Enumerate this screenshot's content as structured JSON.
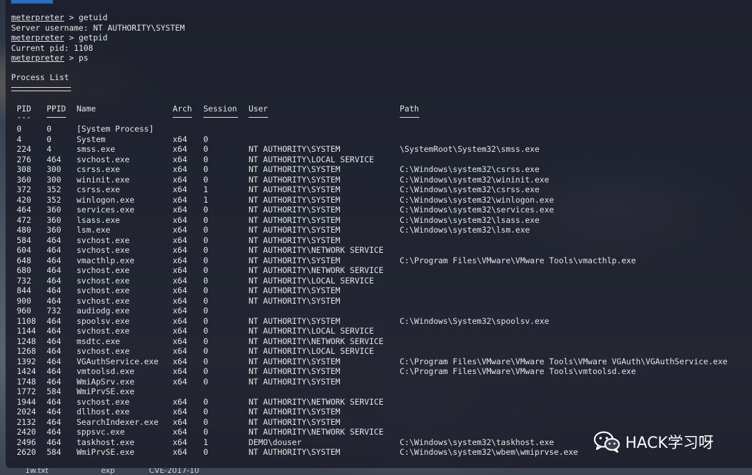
{
  "session": {
    "lines": [
      {
        "prompt": "meterpreter",
        "text": " > getuid"
      },
      {
        "prompt": "",
        "text": "Server username: NT AUTHORITY\\SYSTEM"
      },
      {
        "prompt": "meterpreter",
        "text": " > getpid"
      },
      {
        "prompt": "",
        "text": "Current pid: 1108"
      },
      {
        "prompt": "meterpreter",
        "text": " > ps"
      }
    ],
    "list_title": "Process List"
  },
  "table": {
    "headers": [
      "PID",
      "PPID",
      "Name",
      "Arch",
      "Session",
      "User",
      "Path"
    ],
    "underline": "---",
    "rows": [
      [
        "0",
        "0",
        "[System Process]",
        "",
        "",
        "",
        ""
      ],
      [
        "4",
        "0",
        "System",
        "x64",
        "0",
        "",
        ""
      ],
      [
        "224",
        "4",
        "smss.exe",
        "x64",
        "0",
        "NT AUTHORITY\\SYSTEM",
        "\\SystemRoot\\System32\\smss.exe"
      ],
      [
        "276",
        "464",
        "svchost.exe",
        "x64",
        "0",
        "NT AUTHORITY\\LOCAL SERVICE",
        ""
      ],
      [
        "308",
        "300",
        "csrss.exe",
        "x64",
        "0",
        "NT AUTHORITY\\SYSTEM",
        "C:\\Windows\\system32\\csrss.exe"
      ],
      [
        "360",
        "300",
        "wininit.exe",
        "x64",
        "0",
        "NT AUTHORITY\\SYSTEM",
        "C:\\Windows\\system32\\wininit.exe"
      ],
      [
        "372",
        "352",
        "csrss.exe",
        "x64",
        "1",
        "NT AUTHORITY\\SYSTEM",
        "C:\\Windows\\system32\\csrss.exe"
      ],
      [
        "420",
        "352",
        "winlogon.exe",
        "x64",
        "1",
        "NT AUTHORITY\\SYSTEM",
        "C:\\Windows\\system32\\winlogon.exe"
      ],
      [
        "464",
        "360",
        "services.exe",
        "x64",
        "0",
        "NT AUTHORITY\\SYSTEM",
        "C:\\Windows\\system32\\services.exe"
      ],
      [
        "472",
        "360",
        "lsass.exe",
        "x64",
        "0",
        "NT AUTHORITY\\SYSTEM",
        "C:\\Windows\\system32\\lsass.exe"
      ],
      [
        "480",
        "360",
        "lsm.exe",
        "x64",
        "0",
        "NT AUTHORITY\\SYSTEM",
        "C:\\Windows\\system32\\lsm.exe"
      ],
      [
        "584",
        "464",
        "svchost.exe",
        "x64",
        "0",
        "NT AUTHORITY\\SYSTEM",
        ""
      ],
      [
        "604",
        "464",
        "svchost.exe",
        "x64",
        "0",
        "NT AUTHORITY\\NETWORK SERVICE",
        ""
      ],
      [
        "648",
        "464",
        "vmacthlp.exe",
        "x64",
        "0",
        "NT AUTHORITY\\SYSTEM",
        "C:\\Program Files\\VMware\\VMware Tools\\vmacthlp.exe"
      ],
      [
        "680",
        "464",
        "svchost.exe",
        "x64",
        "0",
        "NT AUTHORITY\\NETWORK SERVICE",
        ""
      ],
      [
        "732",
        "464",
        "svchost.exe",
        "x64",
        "0",
        "NT AUTHORITY\\LOCAL SERVICE",
        ""
      ],
      [
        "844",
        "464",
        "svchost.exe",
        "x64",
        "0",
        "NT AUTHORITY\\SYSTEM",
        ""
      ],
      [
        "900",
        "464",
        "svchost.exe",
        "x64",
        "0",
        "NT AUTHORITY\\SYSTEM",
        ""
      ],
      [
        "960",
        "732",
        "audiodg.exe",
        "x64",
        "0",
        "",
        ""
      ],
      [
        "1108",
        "464",
        "spoolsv.exe",
        "x64",
        "0",
        "NT AUTHORITY\\SYSTEM",
        "C:\\Windows\\System32\\spoolsv.exe"
      ],
      [
        "1144",
        "464",
        "svchost.exe",
        "x64",
        "0",
        "NT AUTHORITY\\LOCAL SERVICE",
        ""
      ],
      [
        "1248",
        "464",
        "msdtc.exe",
        "x64",
        "0",
        "NT AUTHORITY\\NETWORK SERVICE",
        ""
      ],
      [
        "1268",
        "464",
        "svchost.exe",
        "x64",
        "0",
        "NT AUTHORITY\\LOCAL SERVICE",
        ""
      ],
      [
        "1392",
        "464",
        "VGAuthService.exe",
        "x64",
        "0",
        "NT AUTHORITY\\SYSTEM",
        "C:\\Program Files\\VMware\\VMware Tools\\VMware VGAuth\\VGAuthService.exe"
      ],
      [
        "1424",
        "464",
        "vmtoolsd.exe",
        "x64",
        "0",
        "NT AUTHORITY\\SYSTEM",
        "C:\\Program Files\\VMware\\VMware Tools\\vmtoolsd.exe"
      ],
      [
        "1748",
        "464",
        "WmiApSrv.exe",
        "x64",
        "0",
        "NT AUTHORITY\\SYSTEM",
        ""
      ],
      [
        "1772",
        "584",
        "WmiPrvSE.exe",
        "",
        "",
        "",
        ""
      ],
      [
        "1944",
        "464",
        "svchost.exe",
        "x64",
        "0",
        "NT AUTHORITY\\NETWORK SERVICE",
        ""
      ],
      [
        "2024",
        "464",
        "dllhost.exe",
        "x64",
        "0",
        "NT AUTHORITY\\SYSTEM",
        ""
      ],
      [
        "2132",
        "464",
        "SearchIndexer.exe",
        "x64",
        "0",
        "NT AUTHORITY\\SYSTEM",
        ""
      ],
      [
        "2420",
        "464",
        "sppsvc.exe",
        "x64",
        "0",
        "NT AUTHORITY\\NETWORK SERVICE",
        ""
      ],
      [
        "2496",
        "464",
        "taskhost.exe",
        "x64",
        "1",
        "DEMO\\douser",
        "C:\\Windows\\system32\\taskhost.exe"
      ],
      [
        "2620",
        "584",
        "WmiPrvSE.exe",
        "x64",
        "0",
        "NT AUTHORITY\\SYSTEM",
        "C:\\Windows\\system32\\wbem\\wmiprvse.exe"
      ]
    ]
  },
  "watermark": {
    "text": "HACK学习呀",
    "icon": "wechat-icon"
  },
  "desktop_files": [
    "1w.txt",
    "exp",
    "CVE-2017-10"
  ],
  "colors": {
    "terminal_bg": "#1c1f2a",
    "text": "#e6e6e6",
    "accent": "#2f6bbf"
  }
}
